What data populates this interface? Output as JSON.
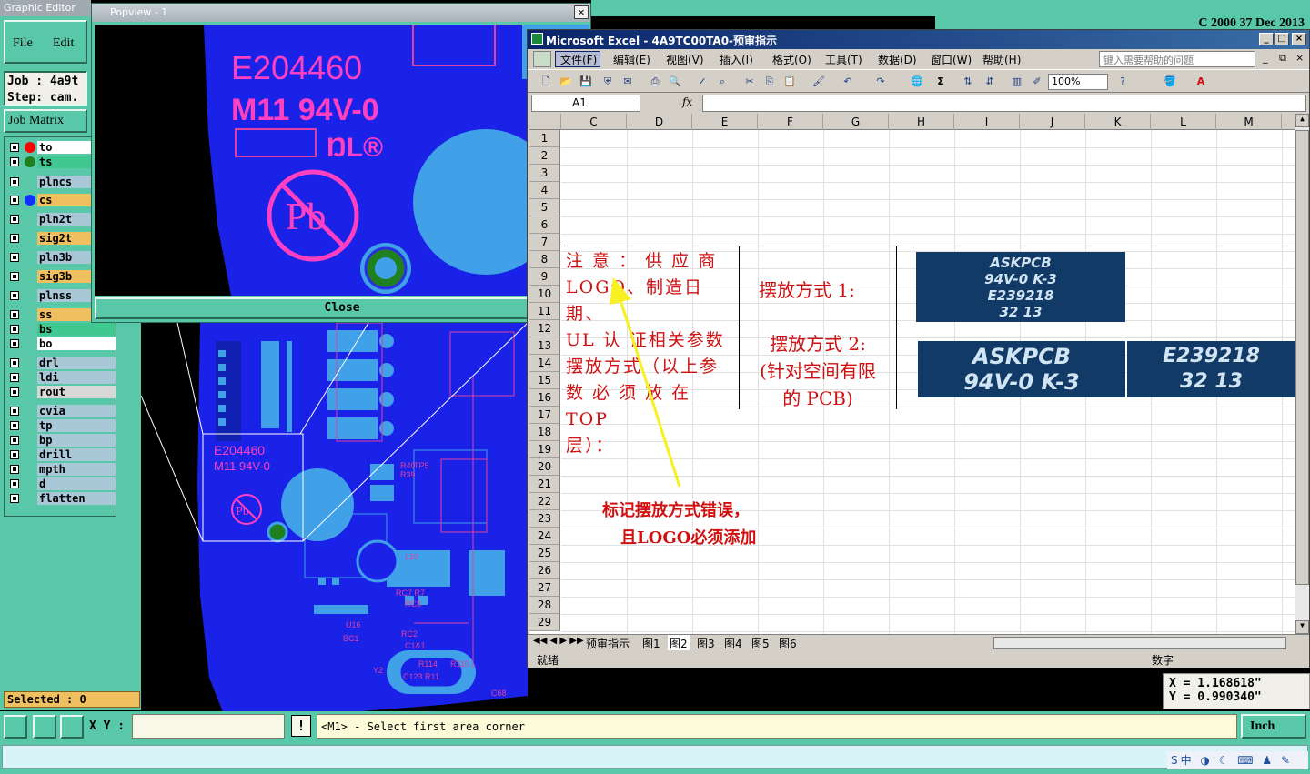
{
  "editor": {
    "title": "Graphic Editor",
    "menu": {
      "file": "File",
      "edit": "Edit"
    },
    "job_label": "Job : 4a9t",
    "step_label": "Step: cam.",
    "job_matrix": "Job Matrix",
    "layers": [
      {
        "name": "to",
        "color": "#ff0000",
        "bg": "#ffffff"
      },
      {
        "name": "ts",
        "color": "#208020",
        "bg": "#40c890"
      },
      {
        "name": "plncs",
        "color": "",
        "bg": "#a8c8d8"
      },
      {
        "name": "cs",
        "color": "#1030ff",
        "bg": "#f0c060"
      },
      {
        "name": "pln2t",
        "color": "",
        "bg": "#a8c8d8"
      },
      {
        "name": "sig2t",
        "color": "",
        "bg": "#f0c060"
      },
      {
        "name": "pln3b",
        "color": "",
        "bg": "#a8c8d8"
      },
      {
        "name": "sig3b",
        "color": "",
        "bg": "#f0c060"
      },
      {
        "name": "plnss",
        "color": "",
        "bg": "#a8c8d8"
      },
      {
        "name": "ss",
        "color": "",
        "bg": "#f0c060"
      },
      {
        "name": "bs",
        "color": "",
        "bg": "#40c890"
      },
      {
        "name": "bo",
        "color": "",
        "bg": "#ffffff"
      },
      {
        "name": "drl",
        "color": "",
        "bg": "#a8c8d8"
      },
      {
        "name": "ldi",
        "color": "",
        "bg": "#a8c8d8"
      },
      {
        "name": "rout",
        "color": "",
        "bg": "#d8d8d8"
      },
      {
        "name": "cvia",
        "color": "",
        "bg": "#a8c8d8"
      },
      {
        "name": "tp",
        "color": "",
        "bg": "#a8c8d8"
      },
      {
        "name": "bp",
        "color": "",
        "bg": "#a8c8d8"
      },
      {
        "name": "drill",
        "color": "",
        "bg": "#a8c8d8"
      },
      {
        "name": "mpth",
        "color": "",
        "bg": "#a8c8d8"
      },
      {
        "name": "d",
        "color": "",
        "bg": "#a8c8d8"
      },
      {
        "name": "flatten",
        "color": "",
        "bg": "#a8c8d8"
      }
    ],
    "selected": "Selected : 0",
    "coord_x": "X =  1.168618\"",
    "coord_y": "Y =  0.990340\"",
    "xy_label": "X Y :",
    "bang": "!",
    "prompt": "<M1> - Select first area corner",
    "unit": "Inch",
    "topright": "C      2000 37 Dec 2013"
  },
  "popview": {
    "title": "Popview - 1",
    "close_x": "✕",
    "close_button": "Close",
    "ul_code": "E204460",
    "rating": "M11 94V-0",
    "pb": "Pb"
  },
  "board": {
    "ul_code": "E204460",
    "rating": "M11 94V-0",
    "pb": "Pb"
  },
  "excel": {
    "title": "Microsoft Excel - 4A9TC00TA0-预审指示",
    "menu": [
      "文件(F)",
      "编辑(E)",
      "视图(V)",
      "插入(I)",
      "格式(O)",
      "工具(T)",
      "数据(D)",
      "窗口(W)",
      "帮助(H)"
    ],
    "help_placeholder": "键入需要帮助的问题",
    "zoom": "100%",
    "name_box": "A1",
    "fx": "fx",
    "columns": [
      "C",
      "D",
      "E",
      "F",
      "G",
      "H",
      "I",
      "J",
      "K",
      "L",
      "M"
    ],
    "rows": [
      "1",
      "2",
      "3",
      "4",
      "5",
      "6",
      "7",
      "8",
      "9",
      "10",
      "11",
      "12",
      "13",
      "14",
      "15",
      "16",
      "17",
      "18",
      "19",
      "20",
      "21",
      "22",
      "23",
      "24",
      "25",
      "26",
      "27",
      "28",
      "29"
    ],
    "note_lines": [
      "注 意 ： 供 应 商",
      "LOGO、制造日期、",
      "UL 认 证相关参数",
      "摆放方式（以上参",
      "数 必 须 放 在 TOP",
      "层）："
    ],
    "method1": "摆放方式 1:",
    "method2_l1": "摆放方式 2:",
    "method2_l2": "(针对空间有限",
    "method2_l3": "的 PCB)",
    "chip1_l1": "ASKPCB",
    "chip1_l2": "94V-0 K-3",
    "chip1_l3": "E239218",
    "chip1_l4": "32 13",
    "chip2_l1": "ASKPCB",
    "chip2_l2": "94V-0 K-3",
    "chip3_l1": "E239218",
    "chip3_l2": "32 13",
    "annotation_l1": "标记摆放方式错误，",
    "annotation_l2": "且LOGO必须添加",
    "sheet_tabs": [
      "预审指示",
      "图1",
      "图2",
      "图3",
      "图4",
      "图5",
      "图6"
    ],
    "status_ready": "就绪",
    "status_num": "数字"
  },
  "tray": "S中 ◑ ☾ ⌨ ♟ ✎"
}
